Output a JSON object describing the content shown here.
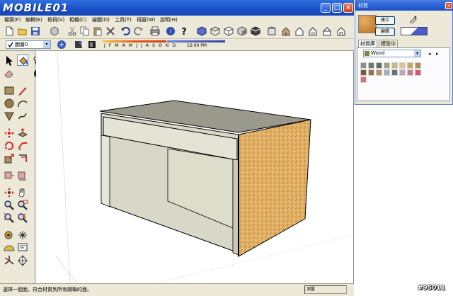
{
  "window": {
    "logo_text": "MOBILE01",
    "minimize": "_",
    "maximize": "□",
    "close": "×"
  },
  "menu": [
    {
      "label": "檔案(F)"
    },
    {
      "label": "編輯(E)"
    },
    {
      "label": "檢視(V)"
    },
    {
      "label": "相機(C)"
    },
    {
      "label": "繪圖(D)"
    },
    {
      "label": "工具(T)"
    },
    {
      "label": "視窗(W)"
    },
    {
      "label": "說明(H)"
    }
  ],
  "layer": {
    "value": "圖層0",
    "dropdown_arrow": "▾"
  },
  "shadow": {
    "months": "J F M A M J J A S O N D",
    "time": "12:00 PM"
  },
  "status": {
    "text": "選擇一個面。符合材質到所有關聯的面。",
    "measure": "測量"
  },
  "materials": {
    "title": "材質",
    "close": "×",
    "create_label": "建立",
    "edit_label": "編輯",
    "tabs": [
      {
        "label": "材質庫"
      },
      {
        "label": "模型中"
      }
    ],
    "library": "Wood",
    "dropdown_arrow": "▾",
    "nav_back": "◂",
    "nav_forward": "▸",
    "swatch_colors": [
      "#8a8f88",
      "#6b7a6a",
      "#5a6f6c",
      "#9da08c",
      "#c7b88a",
      "#d8c49a",
      "#c9a46a",
      "#b48a58",
      "#7a5a3c",
      "#9b7048",
      "#b89070",
      "#a0b0b8",
      "#6c7070",
      "#b8a8b0",
      "#c08088",
      "#d25a6a",
      "#d47080"
    ]
  },
  "watermark": "#95011"
}
